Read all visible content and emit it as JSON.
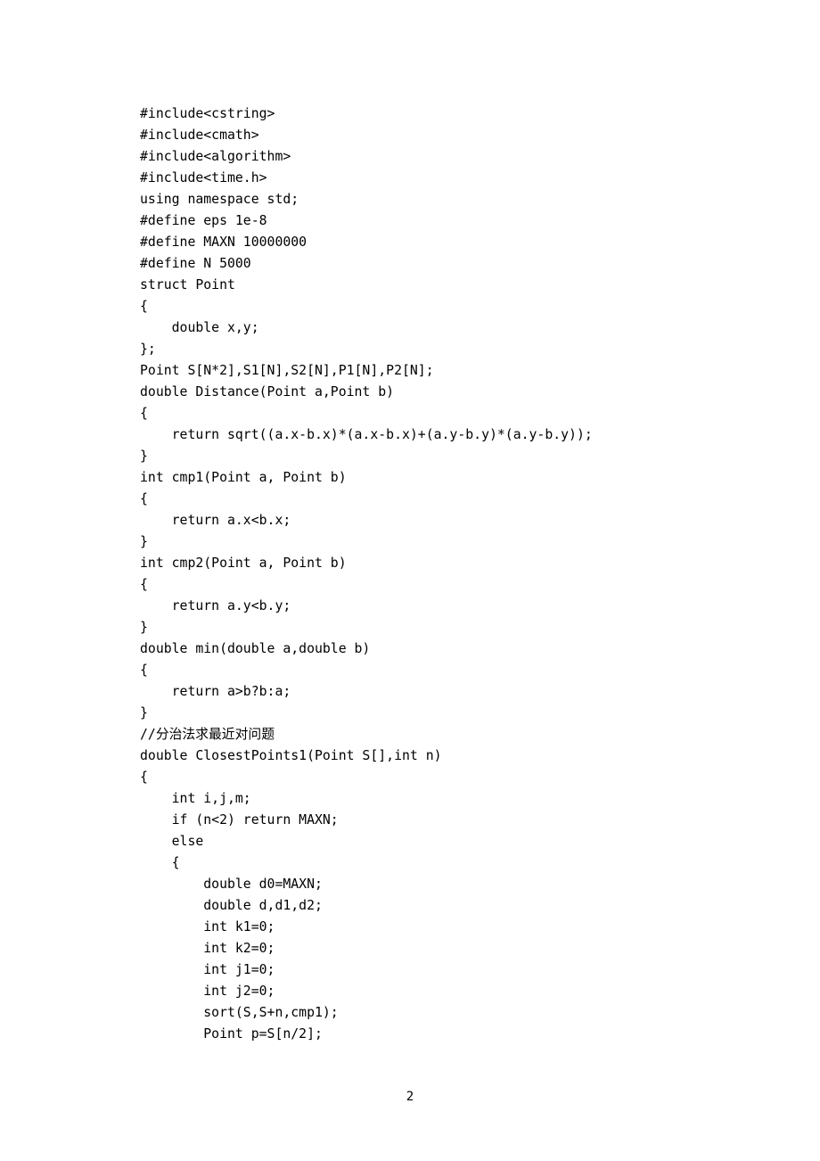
{
  "page_number": "2",
  "lines": [
    "#include<cstring>",
    "#include<cmath>",
    "#include<algorithm>",
    "#include<time.h>",
    "using namespace std;",
    "#define eps 1e-8",
    "#define MAXN 10000000",
    "#define N 5000",
    "struct Point",
    "{",
    "    double x,y;",
    "};",
    "Point S[N*2],S1[N],S2[N],P1[N],P2[N];",
    "double Distance(Point a,Point b)",
    "{",
    "    return sqrt((a.x-b.x)*(a.x-b.x)+(a.y-b.y)*(a.y-b.y));",
    "}",
    "int cmp1(Point a, Point b)",
    "{",
    "    return a.x<b.x;",
    "}",
    "int cmp2(Point a, Point b)",
    "{",
    "    return a.y<b.y;",
    "}",
    "double min(double a,double b)",
    "{",
    "    return a>b?b:a;",
    "}",
    "//分治法求最近对问题",
    "double ClosestPoints1(Point S[],int n)",
    "{",
    "    int i,j,m;",
    "    if (n<2) return MAXN;",
    "    else",
    "    {",
    "        double d0=MAXN;",
    "        double d,d1,d2;",
    "        int k1=0;",
    "        int k2=0;",
    "        int j1=0;",
    "        int j2=0;",
    "        sort(S,S+n,cmp1);",
    "        Point p=S[n/2];"
  ]
}
